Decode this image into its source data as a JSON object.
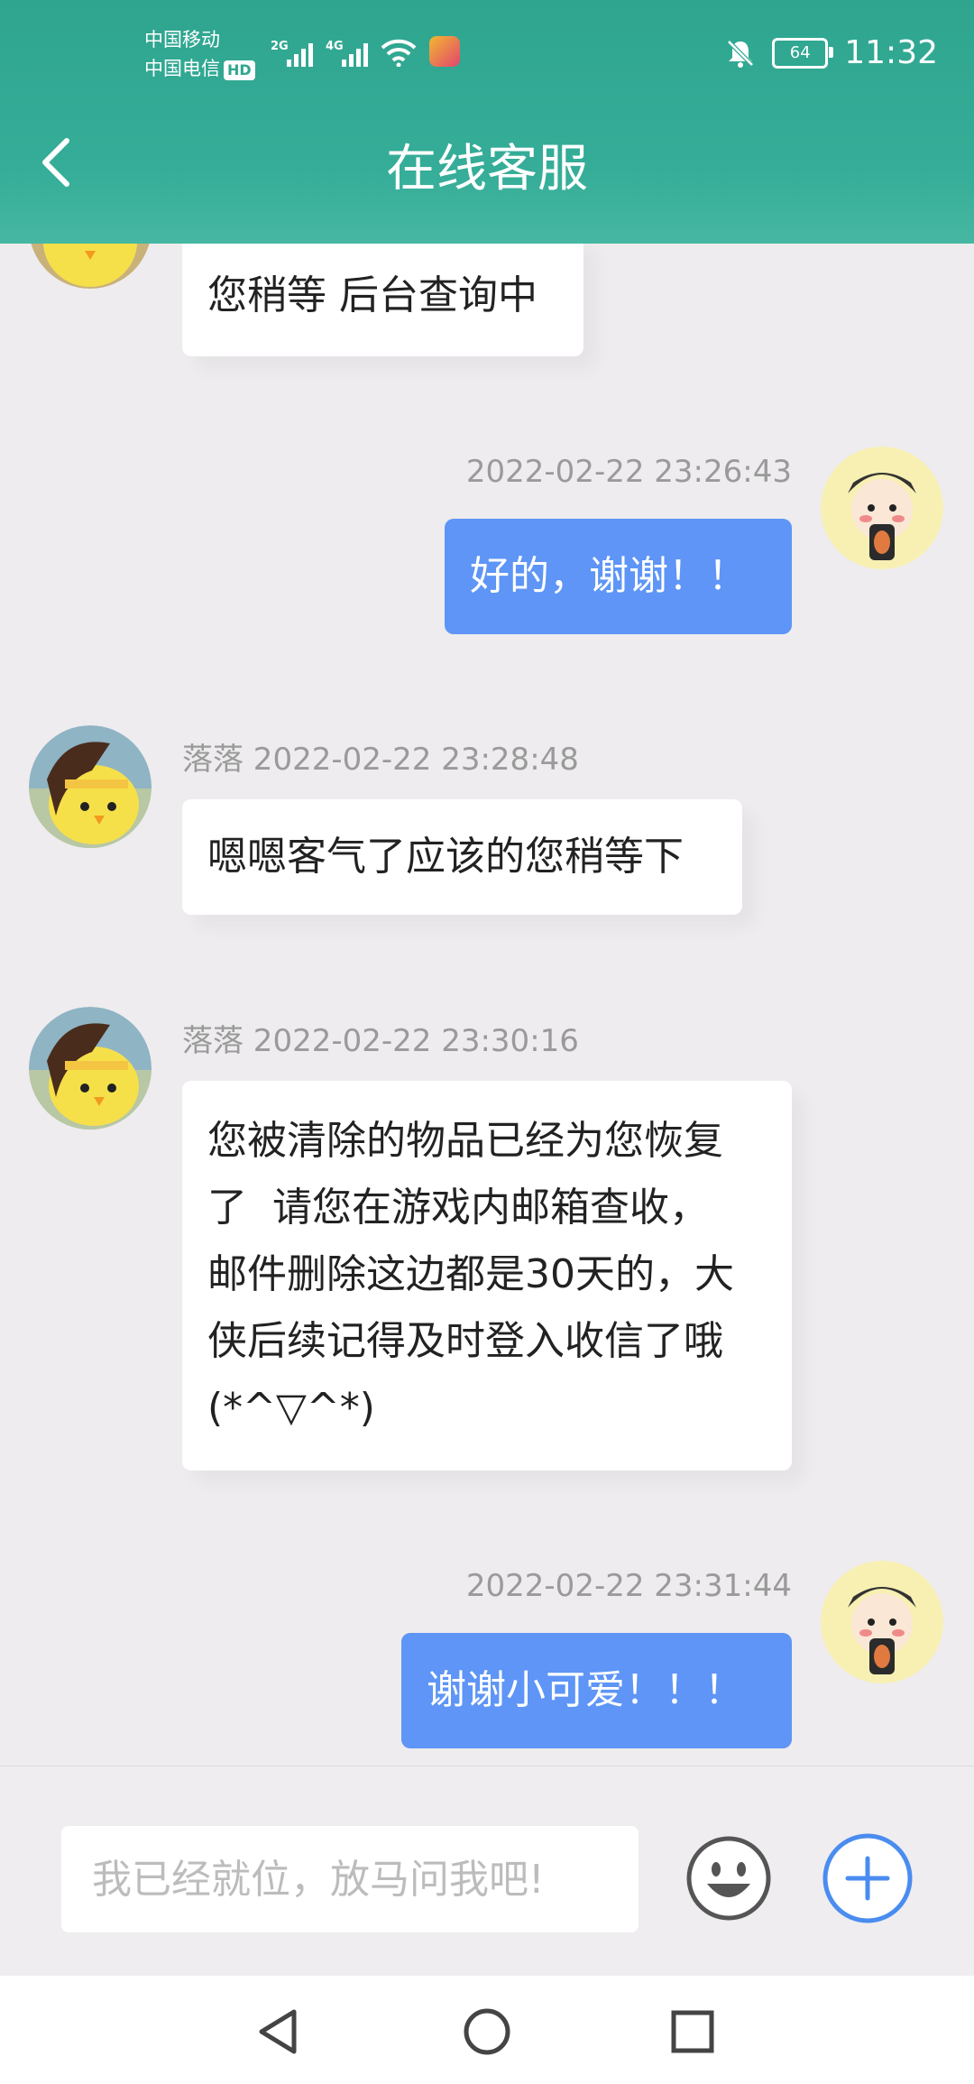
{
  "status": {
    "carrier1": "中国移动",
    "carrier2": "中国电信",
    "hd": "HD",
    "net1": "2G",
    "net2": "4G",
    "battery": "64",
    "time": "11:32"
  },
  "header": {
    "title": "在线客服"
  },
  "messages": [
    {
      "side": "in",
      "meta": "",
      "text": "您稍等 后台查询中"
    },
    {
      "side": "out",
      "meta": "2022-02-22 23:26:43",
      "text": "好的，谢谢！！"
    },
    {
      "side": "in",
      "meta": "落落 2022-02-22 23:28:48",
      "text": "嗯嗯客气了应该的您稍等下"
    },
    {
      "side": "in",
      "meta": "落落 2022-02-22 23:30:16",
      "lines": [
        "您被清除的物品已经为您恢复",
        "了  请您在游戏内邮箱查收，",
        "邮件删除这边都是30天的，大",
        "侠后续记得及时登入收信了哦",
        "(*^▽^*)"
      ]
    },
    {
      "side": "out",
      "meta": "2022-02-22 23:31:44",
      "text": "谢谢小可爱！！！"
    }
  ],
  "input": {
    "placeholder": "我已经就位，放马问我吧!"
  },
  "icons": {
    "back": "chevron-left-icon",
    "emoji": "smiley-icon",
    "plus": "plus-circle-icon",
    "nav_back": "triangle-back-icon",
    "nav_home": "circle-home-icon",
    "nav_recent": "square-recent-icon"
  },
  "colors": {
    "header": "#35ad98",
    "outgoing_bubble": "#5e95f6",
    "incoming_bubble": "#ffffff",
    "background": "#eeecee",
    "plus_button": "#4a8cf0"
  }
}
